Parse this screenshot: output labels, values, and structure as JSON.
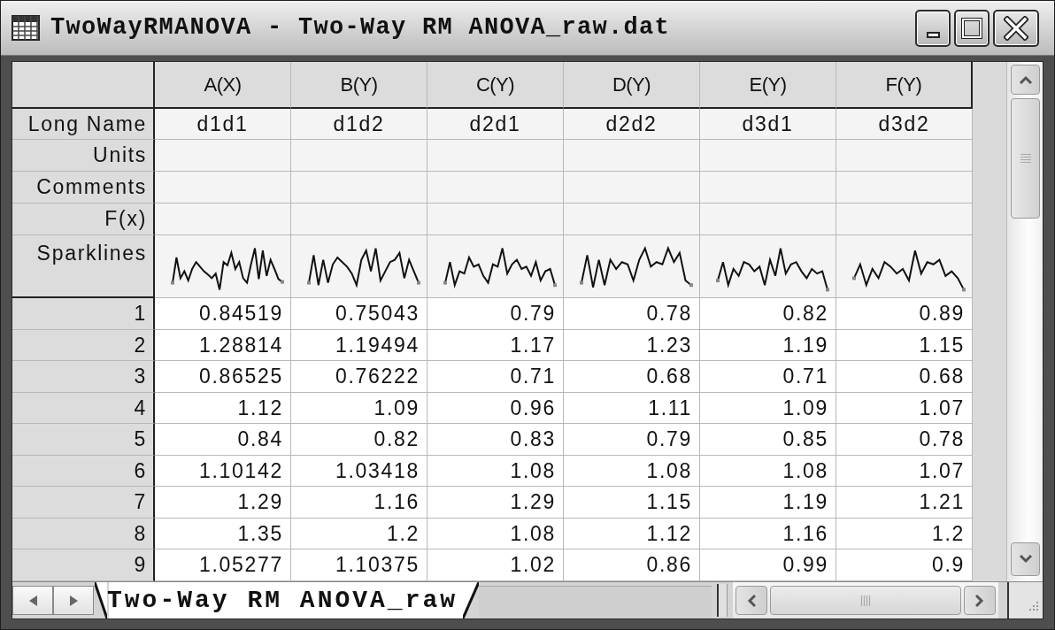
{
  "window": {
    "title": "TwoWayRMANOVA - Two-Way RM ANOVA_raw.dat"
  },
  "worksheet": {
    "columns": [
      "A(X)",
      "B(Y)",
      "C(Y)",
      "D(Y)",
      "E(Y)",
      "F(Y)"
    ],
    "label_rows": [
      {
        "label": "Long Name",
        "kind": "text",
        "cells": [
          "d1d1",
          "d1d2",
          "d2d1",
          "d2d2",
          "d3d1",
          "d3d2"
        ]
      },
      {
        "label": "Units",
        "kind": "text"
      },
      {
        "label": "Comments",
        "kind": "text"
      },
      {
        "label": "F(x)",
        "kind": "text"
      },
      {
        "label": "Sparklines",
        "kind": "sparkline"
      }
    ],
    "rows": [
      {
        "label": "1",
        "cells": [
          "0.84519",
          "0.75043",
          "0.79",
          "0.78",
          "0.82",
          "0.89"
        ]
      },
      {
        "label": "2",
        "cells": [
          "1.28814",
          "1.19494",
          "1.17",
          "1.23",
          "1.19",
          "1.15"
        ]
      },
      {
        "label": "3",
        "cells": [
          "0.86525",
          "0.76222",
          "0.71",
          "0.68",
          "0.71",
          "0.68"
        ]
      },
      {
        "label": "4",
        "cells": [
          "1.12",
          "1.09",
          "0.96",
          "1.11",
          "1.09",
          "1.07"
        ]
      },
      {
        "label": "5",
        "cells": [
          "0.84",
          "0.82",
          "0.83",
          "0.79",
          "0.85",
          "0.78"
        ]
      },
      {
        "label": "6",
        "cells": [
          "1.10142",
          "1.03418",
          "1.08",
          "1.08",
          "1.08",
          "1.07"
        ]
      },
      {
        "label": "7",
        "cells": [
          "1.29",
          "1.16",
          "1.29",
          "1.15",
          "1.19",
          "1.21"
        ]
      },
      {
        "label": "8",
        "cells": [
          "1.35",
          "1.2",
          "1.08",
          "1.12",
          "1.16",
          "1.2"
        ]
      },
      {
        "label": "9",
        "cells": [
          "1.05277",
          "1.10375",
          "1.02",
          "0.86",
          "0.99",
          "0.9"
        ]
      }
    ]
  },
  "sheet_tabs": [
    {
      "label": "Two-Way RM ANOVA_raw",
      "selected": true
    }
  ]
}
